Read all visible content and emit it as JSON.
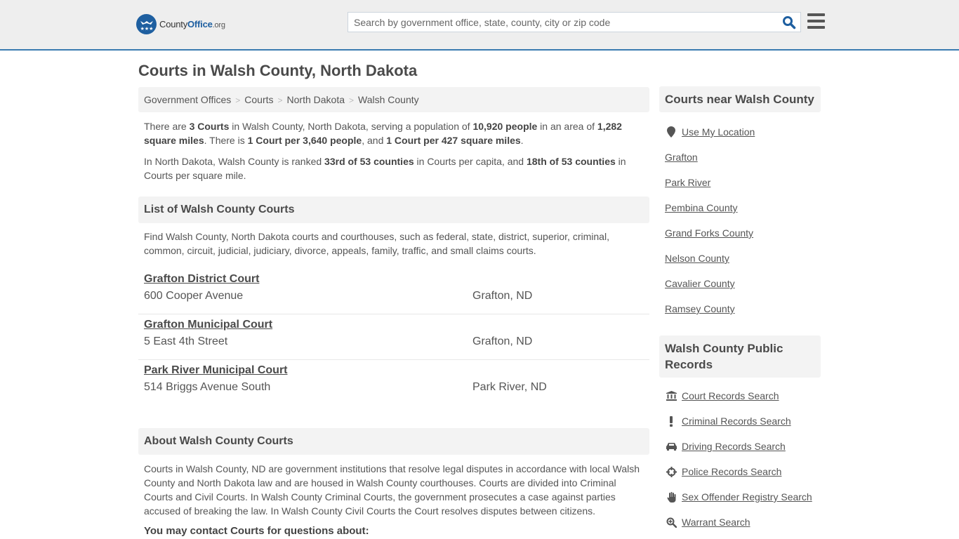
{
  "header": {
    "logo": {
      "name_part1": "County",
      "name_part2": "Office",
      "tld": ".org"
    },
    "search": {
      "placeholder": "Search by government office, state, county, city or zip code",
      "value": ""
    }
  },
  "page_title": "Courts in Walsh County, North Dakota",
  "breadcrumb": [
    "Government Offices",
    "Courts",
    "North Dakota",
    "Walsh County"
  ],
  "summary": {
    "p1": {
      "t1": "There are ",
      "b1": "3 Courts",
      "t2": " in Walsh County, North Dakota, serving a population of ",
      "b2": "10,920 people",
      "t3": " in an area of ",
      "b3": "1,282 square miles",
      "t4": ". There is ",
      "b4": "1 Court per 3,640 people",
      "t5": ", and ",
      "b5": "1 Court per 427 square miles",
      "t6": "."
    },
    "p2": {
      "t1": "In North Dakota, Walsh County is ranked ",
      "b1": "33rd of 53 counties",
      "t2": " in Courts per capita, and ",
      "b2": "18th of 53 counties",
      "t3": " in Courts per square mile."
    }
  },
  "list_section": {
    "heading": "List of Walsh County Courts",
    "intro": "Find Walsh County, North Dakota courts and courthouses, such as federal, state, district, superior, criminal, common, circuit, judicial, judiciary, divorce, appeals, family, traffic, and small claims courts.",
    "courts": [
      {
        "name": "Grafton District Court",
        "address": "600 Cooper Avenue",
        "city": "Grafton, ND"
      },
      {
        "name": "Grafton Municipal Court",
        "address": "5 East 4th Street",
        "city": "Grafton, ND"
      },
      {
        "name": "Park River Municipal Court",
        "address": "514 Briggs Avenue South",
        "city": "Park River, ND"
      }
    ]
  },
  "about_section": {
    "heading": "About Walsh County Courts",
    "text": "Courts in Walsh County, ND are government institutions that resolve legal disputes in accordance with local Walsh County and North Dakota law and are housed in Walsh County courthouses. Courts are divided into Criminal Courts and Civil Courts. In Walsh County Criminal Courts, the government prosecutes a case against parties accused of breaking the law. In Walsh County Civil Courts the Court resolves disputes between citizens.",
    "contact_heading": "You may contact Courts for questions about:"
  },
  "sidebar": {
    "near": {
      "heading": "Courts near Walsh County",
      "use_location": {
        "label": "Use My Location",
        "icon": "map-marker-icon"
      },
      "items": [
        "Grafton",
        "Park River",
        "Pembina County",
        "Grand Forks County",
        "Nelson County",
        "Cavalier County",
        "Ramsey County"
      ]
    },
    "records": {
      "heading": "Walsh County Public Records",
      "items": [
        {
          "label": "Court Records Search",
          "icon": "courthouse-icon"
        },
        {
          "label": "Criminal Records Search",
          "icon": "exclamation-icon"
        },
        {
          "label": "Driving Records Search",
          "icon": "car-icon"
        },
        {
          "label": "Police Records Search",
          "icon": "crosshairs-icon"
        },
        {
          "label": "Sex Offender Registry Search",
          "icon": "hand-icon"
        },
        {
          "label": "Warrant Search",
          "icon": "zoom-in-icon"
        }
      ]
    }
  },
  "colors": {
    "brand_blue": "#1e5fa0",
    "header_border": "#3a7bb0",
    "header_bg": "#eeeeee",
    "section_bg": "#f3f3f3"
  }
}
